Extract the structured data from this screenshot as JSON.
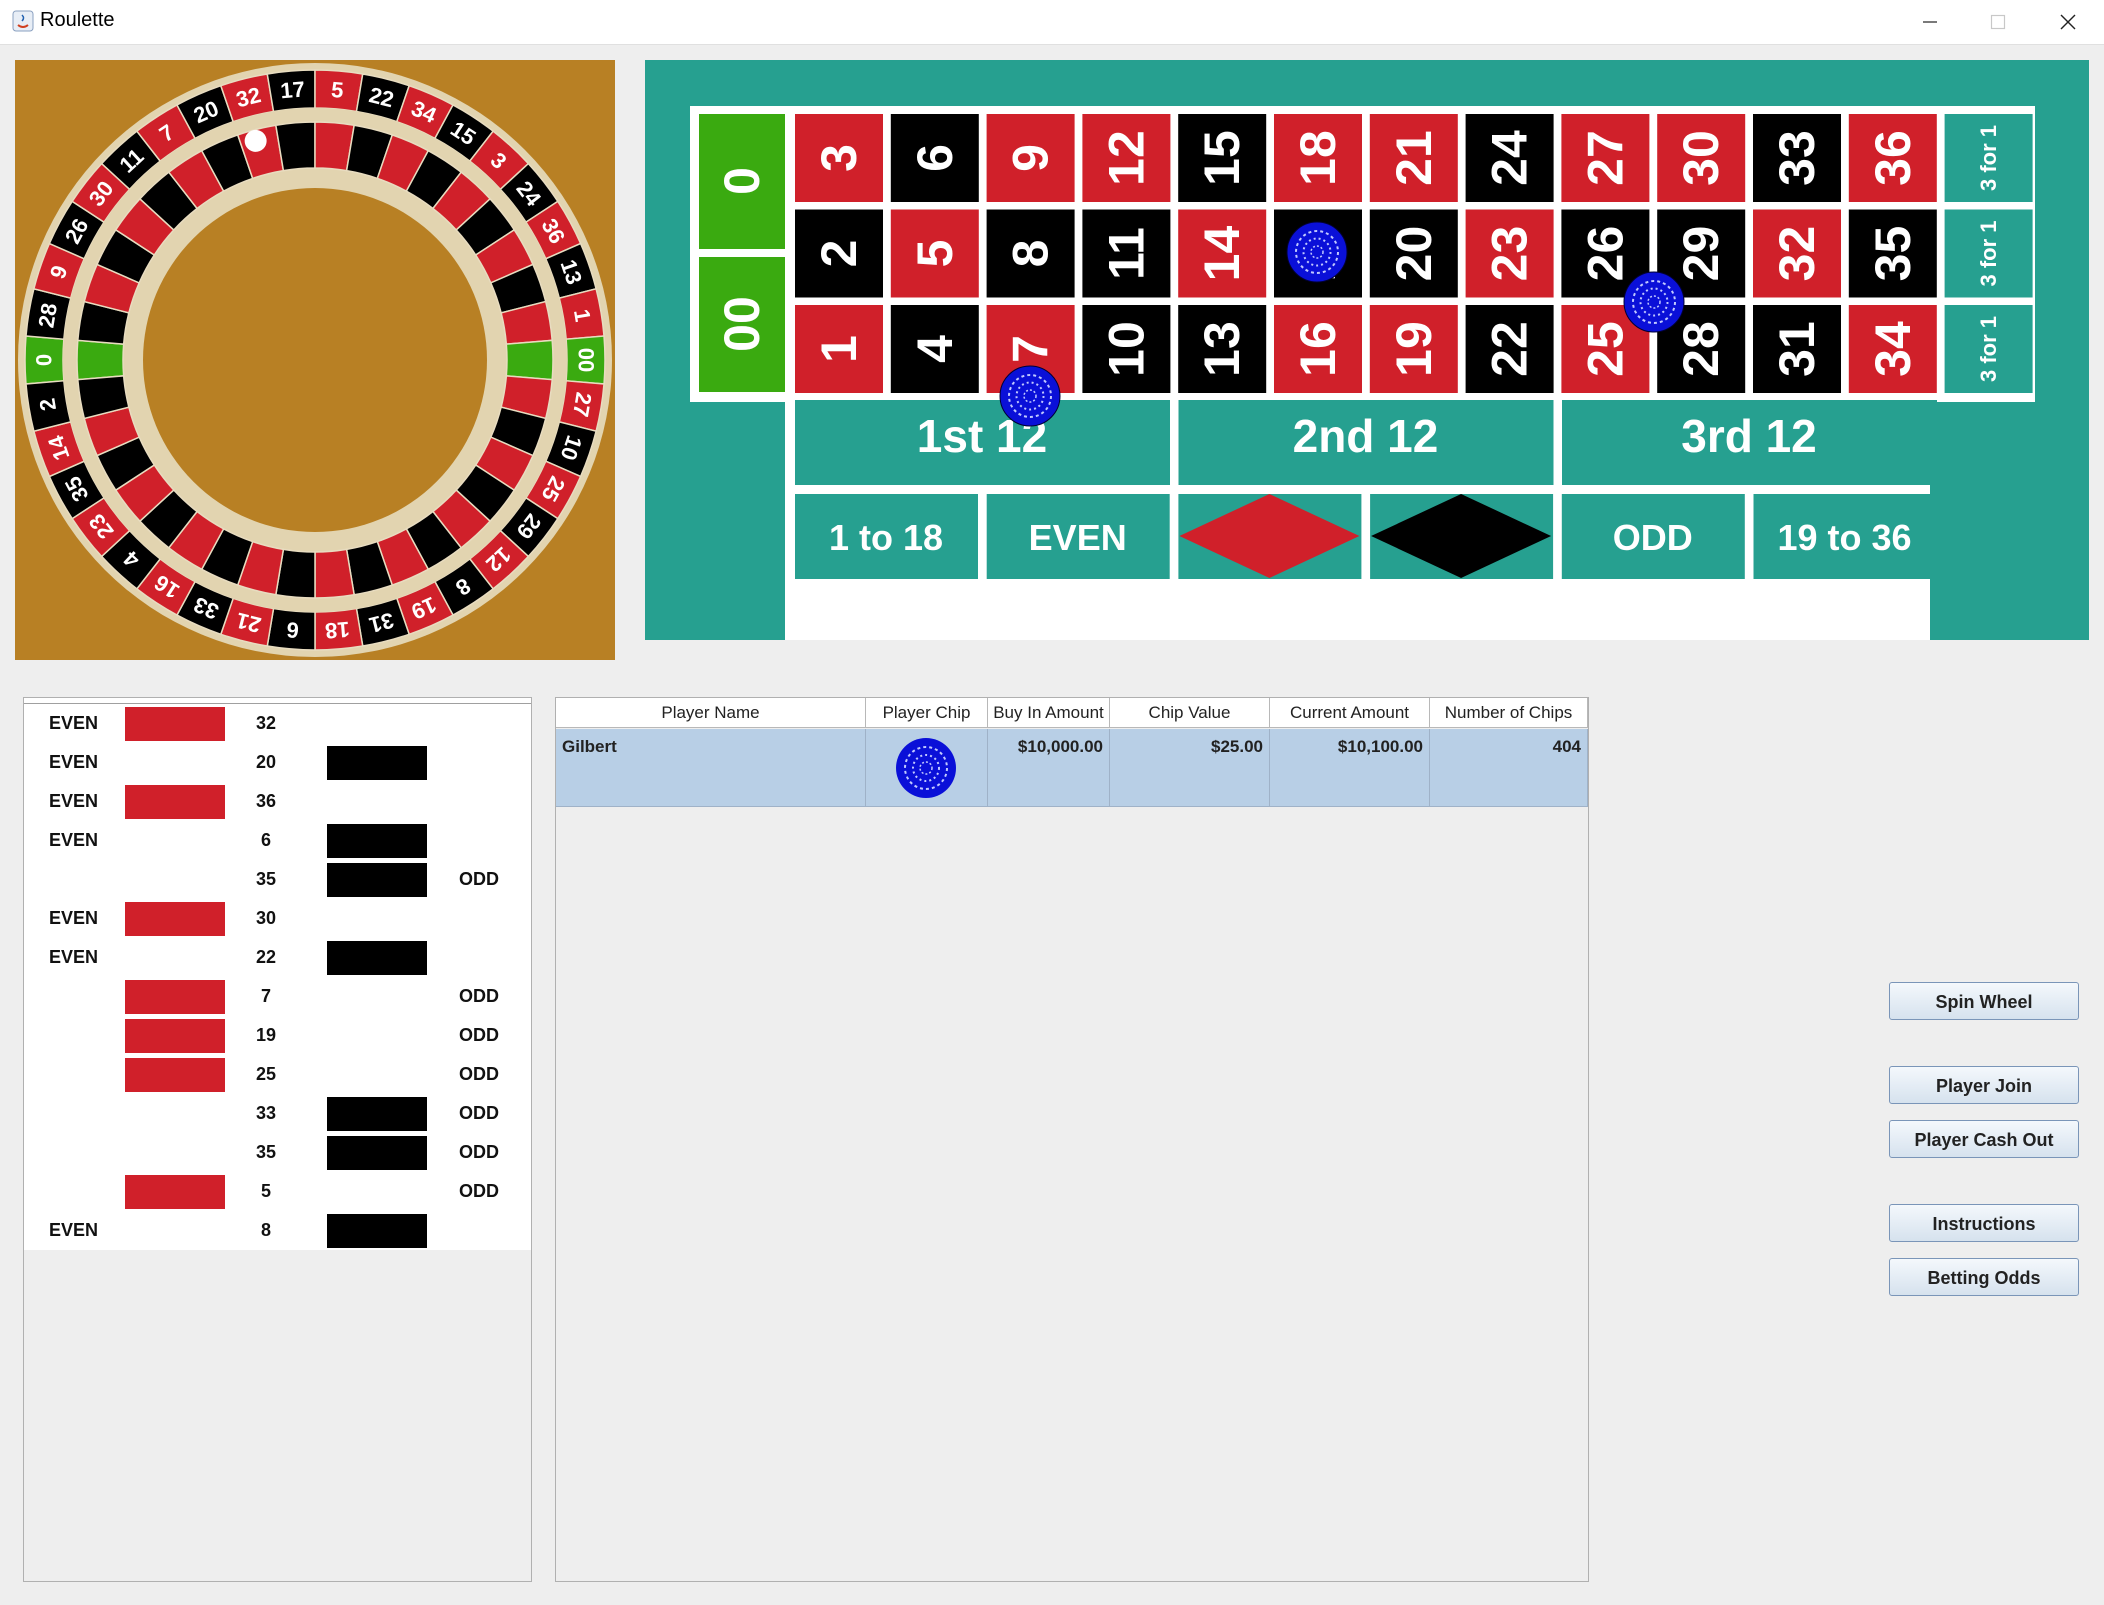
{
  "window": {
    "title": "Roulette",
    "minimize_glyph": "—",
    "maximize_glyph": "☐",
    "close_glyph": "✕"
  },
  "wheel": {
    "sequence": [
      "0",
      "28",
      "9",
      "26",
      "30",
      "11",
      "7",
      "20",
      "32",
      "17",
      "5",
      "22",
      "34",
      "15",
      "3",
      "24",
      "36",
      "13",
      "1",
      "00",
      "27",
      "10",
      "25",
      "29",
      "12",
      "8",
      "19",
      "31",
      "18",
      "6",
      "21",
      "33",
      "16",
      "4",
      "23",
      "35",
      "14",
      "2"
    ],
    "ball_position_label": "32"
  },
  "table": {
    "zero_label": "0",
    "double_zero_label": "00",
    "columns": [
      [
        "3",
        "2",
        "1"
      ],
      [
        "6",
        "5",
        "4"
      ],
      [
        "9",
        "8",
        "7"
      ],
      [
        "12",
        "11",
        "10"
      ],
      [
        "15",
        "14",
        "13"
      ],
      [
        "18",
        "17",
        "16"
      ],
      [
        "21",
        "20",
        "19"
      ],
      [
        "24",
        "23",
        "22"
      ],
      [
        "27",
        "26",
        "25"
      ],
      [
        "30",
        "29",
        "28"
      ],
      [
        "33",
        "32",
        "31"
      ],
      [
        "36",
        "35",
        "34"
      ]
    ],
    "red_numbers": [
      "1",
      "3",
      "5",
      "7",
      "9",
      "12",
      "14",
      "16",
      "18",
      "19",
      "21",
      "23",
      "25",
      "27",
      "30",
      "32",
      "34",
      "36"
    ],
    "column_bets": [
      "3 for 1",
      "3 for 1",
      "3 for 1"
    ],
    "dozens": [
      "1st 12",
      "2nd 12",
      "3rd 12"
    ],
    "outside": [
      "1 to 18",
      "EVEN",
      "",
      "",
      "ODD",
      "19 to 36"
    ],
    "colors": {
      "felt": "#26a090",
      "red": "#d0202a",
      "black": "#000000",
      "green": "#3aaa10",
      "chip": "#0a10d8"
    },
    "chip_locations": [
      "17 (hidden under chip)",
      "7",
      "25/26/28/29 corner"
    ]
  },
  "history": {
    "rows": [
      {
        "even": "EVEN",
        "color": "red",
        "number": "32",
        "odd": ""
      },
      {
        "even": "EVEN",
        "color": "black",
        "number": "20",
        "odd": ""
      },
      {
        "even": "EVEN",
        "color": "red",
        "number": "36",
        "odd": ""
      },
      {
        "even": "EVEN",
        "color": "black",
        "number": "6",
        "odd": ""
      },
      {
        "even": "",
        "color": "black",
        "number": "35",
        "odd": "ODD"
      },
      {
        "even": "EVEN",
        "color": "red",
        "number": "30",
        "odd": ""
      },
      {
        "even": "EVEN",
        "color": "black",
        "number": "22",
        "odd": ""
      },
      {
        "even": "",
        "color": "red",
        "number": "7",
        "odd": "ODD"
      },
      {
        "even": "",
        "color": "red",
        "number": "19",
        "odd": "ODD"
      },
      {
        "even": "",
        "color": "red",
        "number": "25",
        "odd": "ODD"
      },
      {
        "even": "",
        "color": "black",
        "number": "33",
        "odd": "ODD"
      },
      {
        "even": "",
        "color": "black",
        "number": "35",
        "odd": "ODD"
      },
      {
        "even": "",
        "color": "red",
        "number": "5",
        "odd": "ODD"
      },
      {
        "even": "EVEN",
        "color": "black",
        "number": "8",
        "odd": ""
      }
    ]
  },
  "players": {
    "headers": [
      "Player Name",
      "Player Chip",
      "Buy In Amount",
      "Chip Value",
      "Current Amount",
      "Number of Chips"
    ],
    "rows": [
      {
        "name": "Gilbert",
        "chip": "blue-chip",
        "buy_in": "$10,000.00",
        "chip_value": "$25.00",
        "current": "$10,100.00",
        "num_chips": "404"
      }
    ]
  },
  "buttons": {
    "spin": "Spin Wheel",
    "join": "Player Join",
    "cash_out": "Player Cash Out",
    "instructions": "Instructions",
    "odds": "Betting Odds"
  }
}
